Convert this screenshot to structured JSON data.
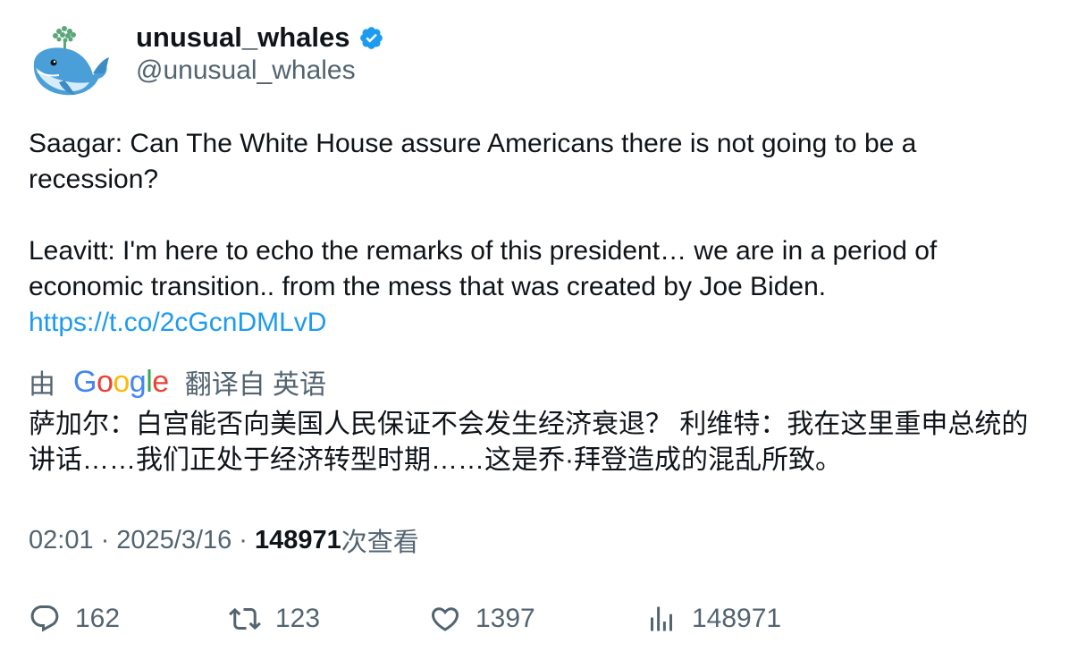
{
  "author": {
    "display_name": "unusual_whales",
    "handle": "@unusual_whales",
    "verified": true
  },
  "tweet": {
    "paragraph_1": "Saagar: Can The White House assure Americans there is not going to be a recession?",
    "paragraph_2": "Leavitt: I'm here to echo the remarks of this president… we are in a period of economic transition..   from the mess that was created by Joe Biden.",
    "link": "https://t.co/2cGcnDMLvD"
  },
  "translation": {
    "prefix": "由",
    "provider": "Google",
    "suffix": "翻译自 英语",
    "text": "萨加尔：白宫能否向美国人民保证不会发生经济衰退？ 利维特：我在这里重申总统的讲话……我们正处于经济转型时期……这是乔·拜登造成的混乱所致。"
  },
  "meta": {
    "time": "02:01",
    "sep1": "·",
    "date": "2025/3/16",
    "sep2": "·",
    "views_count": "148971",
    "views_label": "次查看"
  },
  "actions": {
    "replies": "162",
    "retweets": "123",
    "likes": "1397",
    "views": "148971"
  },
  "colors": {
    "link": "#1d9bf0",
    "secondary_text": "#536471",
    "primary_text": "#0f1419",
    "verified": "#1d9bf0"
  },
  "icons": {
    "avatar": "whale-avatar",
    "verified": "verified-badge-icon",
    "reply": "reply-icon",
    "retweet": "retweet-icon",
    "like": "heart-icon",
    "views": "views-chart-icon"
  }
}
